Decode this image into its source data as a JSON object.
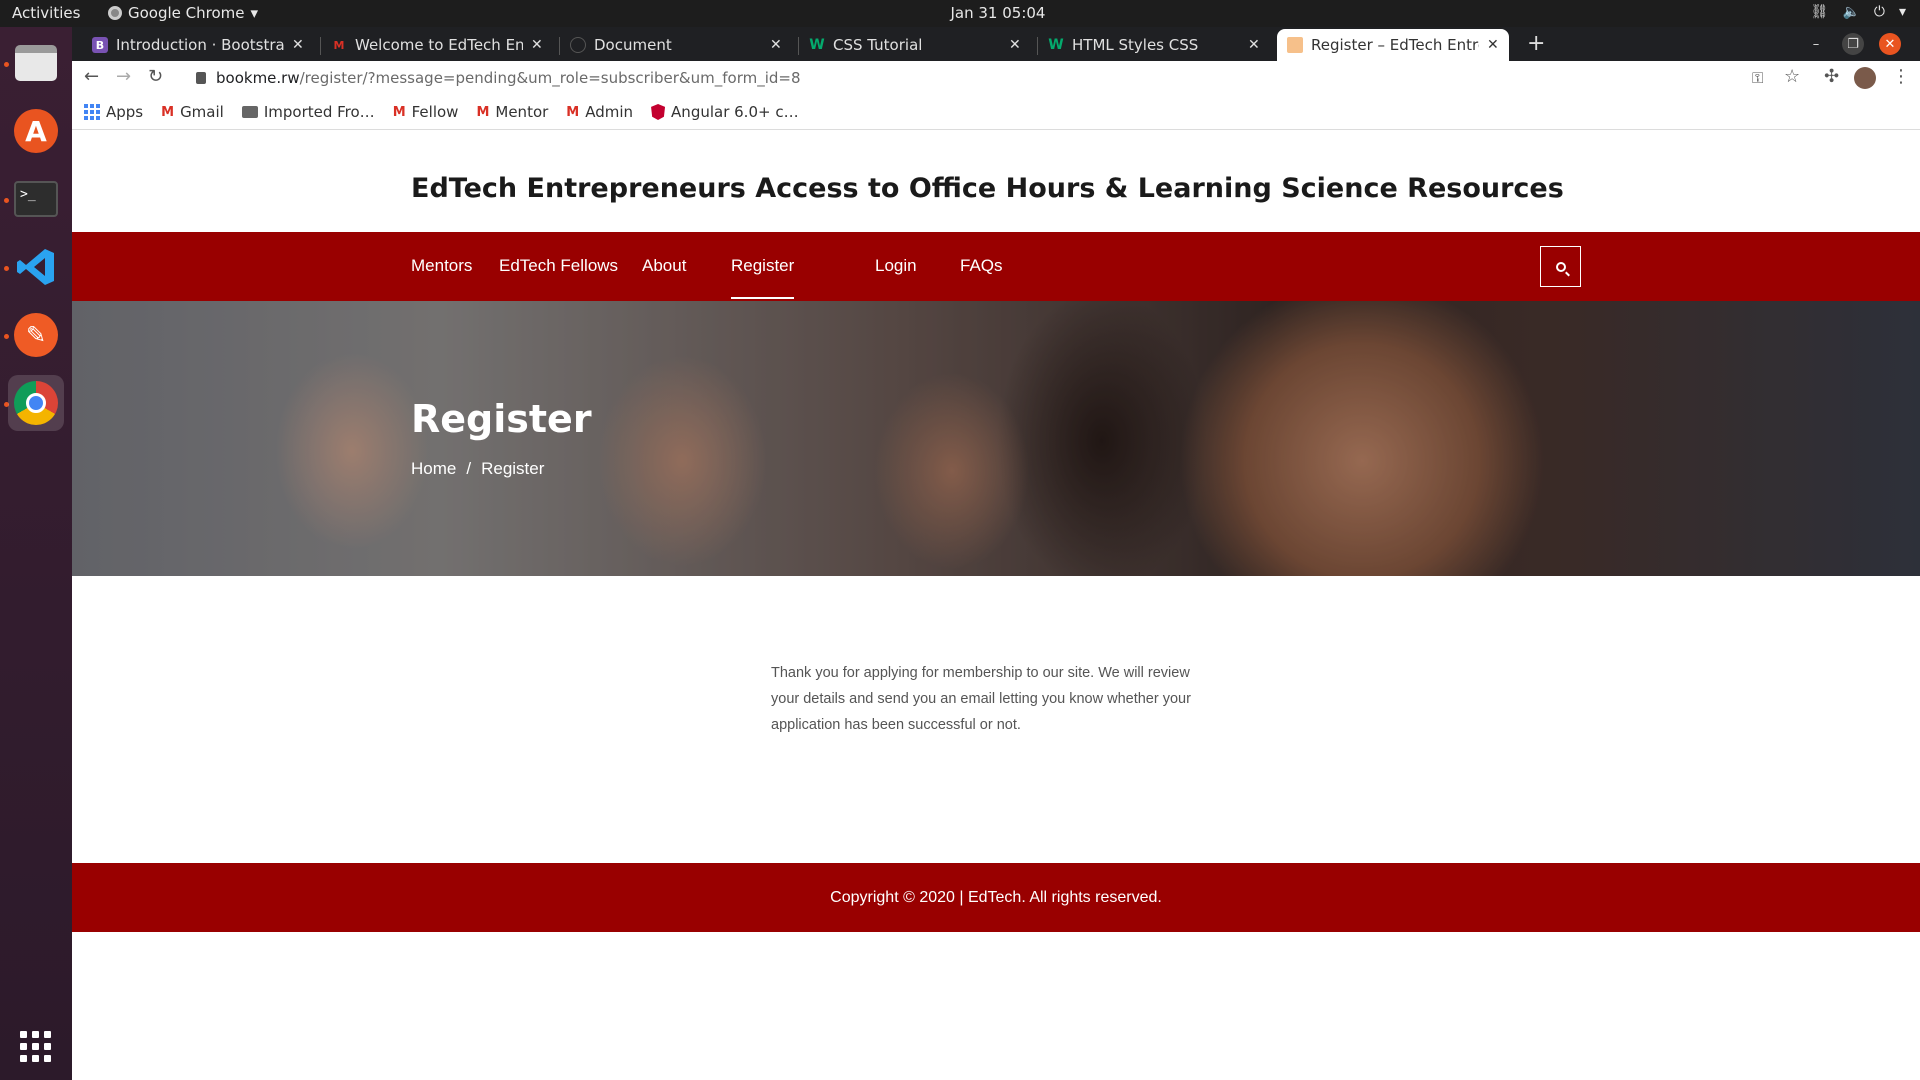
{
  "os_bar": {
    "activities": "Activities",
    "app_name": "Google Chrome",
    "clock": "Jan 31  05:04"
  },
  "tabs": [
    {
      "title": "Introduction · Bootstrap v",
      "favicon": "bootstrap-icon"
    },
    {
      "title": "Welcome to EdTech Entre",
      "favicon": "gmail-icon"
    },
    {
      "title": "Document",
      "favicon": "blank-icon"
    },
    {
      "title": "CSS Tutorial",
      "favicon": "w3schools-icon"
    },
    {
      "title": "HTML Styles CSS",
      "favicon": "w3schools-icon"
    },
    {
      "title": "Register – EdTech Entrepr",
      "favicon": "site-icon"
    }
  ],
  "address": {
    "host": "bookme.rw",
    "path": "/register/?message=pending&um_role=subscriber&um_form_id=8"
  },
  "bookmarks": [
    {
      "label": "Apps",
      "icon": "apps-grid-icon"
    },
    {
      "label": "Gmail",
      "icon": "gmail-icon"
    },
    {
      "label": "Imported Fro…",
      "icon": "folder-icon"
    },
    {
      "label": "Fellow",
      "icon": "gmail-icon"
    },
    {
      "label": "Mentor",
      "icon": "gmail-icon"
    },
    {
      "label": "Admin",
      "icon": "gmail-icon"
    },
    {
      "label": "Angular 6.0+ c…",
      "icon": "angular-icon"
    }
  ],
  "site": {
    "title": "EdTech Entrepreneurs Access to Office Hours & Learning Science Resources",
    "nav": [
      "Mentors",
      "EdTech Fellows",
      "About",
      "Register",
      "Login",
      "FAQs"
    ],
    "active_nav": "Register",
    "brand_color": "#990000"
  },
  "hero": {
    "title": "Register",
    "breadcrumb_home": "Home",
    "breadcrumb_sep": "/",
    "breadcrumb_current": "Register"
  },
  "message": "Thank you for applying for membership to our site. We will review your details and send you an email letting you know whether your application has been successful or not.",
  "footer": "Copyright © 2020 | EdTech. All rights reserved."
}
